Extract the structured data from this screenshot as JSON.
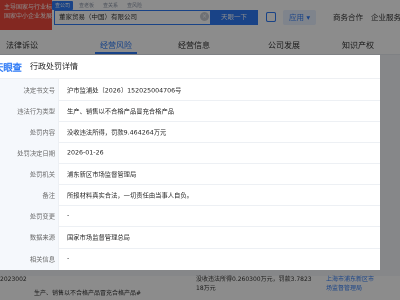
{
  "header": {
    "logo_line1": "主导国家与行业标准制",
    "logo_line2": "国家中小企业发展子基金旗下机构",
    "search_tabs": [
      "查公司",
      "查老板",
      "查关系",
      "查风险"
    ],
    "search_value": "董家贸易（中国）有限公司",
    "search_button": "天眼一下",
    "app_label": "应用",
    "links": [
      "商务合作",
      "企业服务"
    ]
  },
  "nav": {
    "items": [
      "法律诉讼",
      "经营风险",
      "经营信息",
      "公司发展",
      "知识产权"
    ],
    "active_index": 1
  },
  "modal": {
    "brand": "天眼查",
    "title": "行政处罚详情",
    "rows": [
      {
        "label": "决定书文号",
        "value": "沪市监浦处〔2026〕152025004706号"
      },
      {
        "label": "违法行为类型",
        "value": "生产、销售以不合格产品冒充合格产品"
      },
      {
        "label": "处罚内容",
        "value": "没收违法所得，罚款9.464264万元"
      },
      {
        "label": "处罚决定日期",
        "value": "2026-01-26"
      },
      {
        "label": "处罚机关",
        "value": "浦东新区市场监督管理局"
      },
      {
        "label": "备注",
        "value": "所报材料真实合法，一切责任由当事人自负。"
      },
      {
        "label": "处罚变更",
        "value": "-"
      },
      {
        "label": "数据来源",
        "value": "国家市场监督管理总局"
      },
      {
        "label": "相关信息",
        "value": "-"
      }
    ]
  },
  "background_table": {
    "doc_fragment": "2023002",
    "violation": "生产、销售以不合格产品冒充合格产品#",
    "penalty_line1": "没收违法所得0.260300万元，罚款3.7823",
    "penalty_line2": "18万元",
    "authority_line1": "上海市浦东新区市",
    "authority_line2": "场监督管理局"
  },
  "colors": {
    "accent": "#2f7bf6",
    "logo_red": "#ee4a3d",
    "label_bg": "#f5f8fc",
    "overlay": "rgba(0,0,0,0.45)"
  }
}
